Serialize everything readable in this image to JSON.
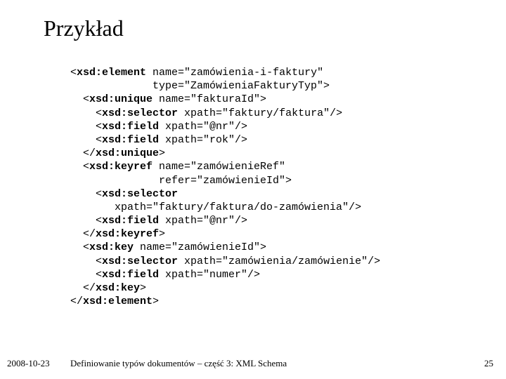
{
  "title": "Przykład",
  "code": {
    "l1a": "<",
    "l1b": "xsd:element",
    "l1c": " name=\"zamówienia-i-faktury\"",
    "l2": "             type=\"ZamówieniaFakturyTyp\">",
    "l3a": "  <",
    "l3b": "xsd:unique",
    "l3c": " name=\"fakturaId\">",
    "l4a": "    <",
    "l4b": "xsd:selector",
    "l4c": " xpath=\"faktury/faktura\"/>",
    "l5a": "    <",
    "l5b": "xsd:field",
    "l5c": " xpath=\"@nr\"/>",
    "l6a": "    <",
    "l6b": "xsd:field",
    "l6c": " xpath=\"rok\"/>",
    "l7a": "  </",
    "l7b": "xsd:unique",
    "l7c": ">",
    "l8a": "  <",
    "l8b": "xsd:keyref",
    "l8c": " name=\"zamówienieRef\"",
    "l9": "              refer=\"zamówienieId\">",
    "l10a": "    <",
    "l10b": "xsd:selector",
    "l11": "       xpath=\"faktury/faktura/do-zamówienia\"/>",
    "l12a": "    <",
    "l12b": "xsd:field",
    "l12c": " xpath=\"@nr\"/>",
    "l13a": "  </",
    "l13b": "xsd:keyref",
    "l13c": ">",
    "l14a": "  <",
    "l14b": "xsd:key",
    "l14c": " name=\"zamówienieId\">",
    "l15a": "    <",
    "l15b": "xsd:selector",
    "l15c": " xpath=\"zamówienia/zamówienie\"/>",
    "l16a": "    <",
    "l16b": "xsd:field",
    "l16c": " xpath=\"numer\"/>",
    "l17a": "  </",
    "l17b": "xsd:key",
    "l17c": ">",
    "l18a": "</",
    "l18b": "xsd:element",
    "l18c": ">"
  },
  "footer": {
    "date": "2008-10-23",
    "caption": "Definiowanie typów dokumentów – część 3: XML Schema",
    "pagenum": "25"
  }
}
